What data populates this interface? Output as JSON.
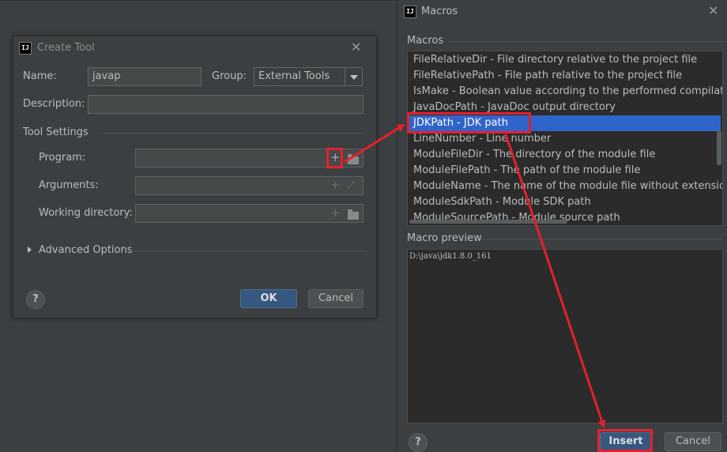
{
  "create_tool": {
    "title": "Create Tool",
    "name_label": "Name:",
    "name_value": "javap",
    "group_label": "Group:",
    "group_value": "External Tools",
    "description_label": "Description:",
    "tool_settings_label": "Tool Settings",
    "program_label": "Program:",
    "arguments_label": "Arguments:",
    "working_dir_label": "Working directory:",
    "advanced_label": "Advanced Options",
    "help_label": "?",
    "ok_label": "OK",
    "cancel_label": "Cancel"
  },
  "macros_dialog": {
    "title": "Macros",
    "macros_section_label": "Macros",
    "items": [
      {
        "label": "FileRelativeDir - File directory relative to the project file"
      },
      {
        "label": "FileRelativePath - File path relative to the project file"
      },
      {
        "label": "IsMake - Boolean value according to the performed compilation: tr"
      },
      {
        "label": "JavaDocPath - JavaDoc output directory"
      },
      {
        "label": "JDKPath - JDK path",
        "selected": true
      },
      {
        "label": "LineNumber - Line number"
      },
      {
        "label": "ModuleFileDir - The directory of the module file"
      },
      {
        "label": "ModuleFilePath - The path of the module file"
      },
      {
        "label": "ModuleName - The name of the module file without extension"
      },
      {
        "label": "ModuleSdkPath - Module SDK path"
      },
      {
        "label": "ModuleSourcePath - Module source path"
      }
    ],
    "preview_label": "Macro preview",
    "preview_value": "D:\\java\\jdk1.8.0_161",
    "help_label": "?",
    "insert_label": "Insert",
    "cancel_label": "Cancel"
  },
  "icons": {
    "app": "intellij-icon",
    "close": "close-icon",
    "add": "plus-icon",
    "folder": "folder-icon",
    "expand": "expand-icon",
    "combo": "chevron-down-icon"
  },
  "colors": {
    "background": "#3c3f41",
    "selection": "#2f65ca",
    "primary_button": "#365880",
    "annotation": "#e5202c"
  }
}
